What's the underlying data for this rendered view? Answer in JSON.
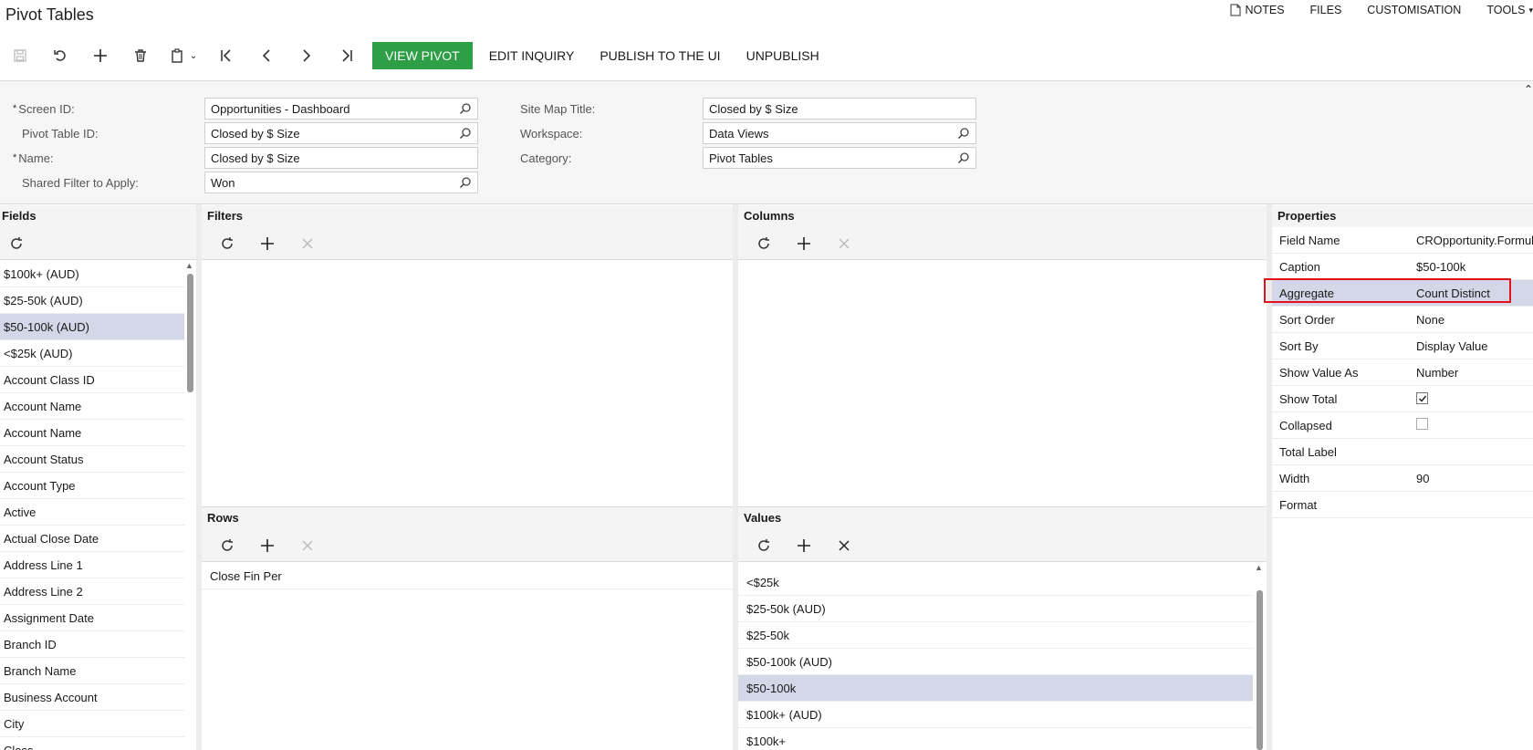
{
  "page_title": "Pivot Tables",
  "top_links": {
    "notes": "NOTES",
    "files": "FILES",
    "customisation": "CUSTOMISATION",
    "tools": "TOOLS"
  },
  "toolbar": {
    "view_pivot": "VIEW PIVOT",
    "edit_inquiry": "EDIT INQUIRY",
    "publish": "PUBLISH TO THE UI",
    "unpublish": "UNPUBLISH"
  },
  "form": {
    "screen_id_label": "Screen ID:",
    "screen_id_value": "Opportunities - Dashboard",
    "pivot_table_id_label": "Pivot Table ID:",
    "pivot_table_id_value": "Closed by $ Size",
    "name_label": "Name:",
    "name_value": "Closed by $ Size",
    "shared_filter_label": "Shared Filter to Apply:",
    "shared_filter_value": "Won",
    "site_map_title_label": "Site Map Title:",
    "site_map_title_value": "Closed by $ Size",
    "workspace_label": "Workspace:",
    "workspace_value": "Data Views",
    "category_label": "Category:",
    "category_value": "Pivot Tables"
  },
  "fields_panel": {
    "title": "Fields",
    "items": [
      "$100k+ (AUD)",
      "$25-50k (AUD)",
      "$50-100k (AUD)",
      "<$25k (AUD)",
      "Account Class ID",
      "Account Name",
      "Account Name",
      "Account Status",
      "Account Type",
      "Active",
      "Actual Close Date",
      "Address Line 1",
      "Address Line 2",
      "Assignment Date",
      "Branch ID",
      "Branch Name",
      "Business Account",
      "City",
      "Class"
    ],
    "selected_index": 2
  },
  "filters_panel": {
    "title": "Filters"
  },
  "columns_panel": {
    "title": "Columns"
  },
  "rows_panel": {
    "title": "Rows",
    "items": [
      "Close Fin Per"
    ]
  },
  "values_panel": {
    "title": "Values",
    "items": [
      "<$25k",
      "$25-50k (AUD)",
      "$25-50k",
      "$50-100k (AUD)",
      "$50-100k",
      "$100k+ (AUD)",
      "$100k+"
    ],
    "selected_index": 4
  },
  "properties_panel": {
    "title": "Properties",
    "rows": [
      {
        "name": "Field Name",
        "value": "CROpportunity.Formul"
      },
      {
        "name": "Caption",
        "value": "$50-100k"
      },
      {
        "name": "Aggregate",
        "value": "Count Distinct"
      },
      {
        "name": "Sort Order",
        "value": "None"
      },
      {
        "name": "Sort By",
        "value": "Display Value"
      },
      {
        "name": "Show Value As",
        "value": "Number"
      },
      {
        "name": "Show Total",
        "value": ""
      },
      {
        "name": "Collapsed",
        "value": ""
      },
      {
        "name": "Total Label",
        "value": ""
      },
      {
        "name": "Width",
        "value": "90"
      },
      {
        "name": "Format",
        "value": ""
      }
    ],
    "show_total_checked": true,
    "collapsed_checked": false
  },
  "colors": {
    "primary_button": "#2e9e47",
    "selection": "#d3d7e8",
    "highlight_box": "#e0121a"
  }
}
